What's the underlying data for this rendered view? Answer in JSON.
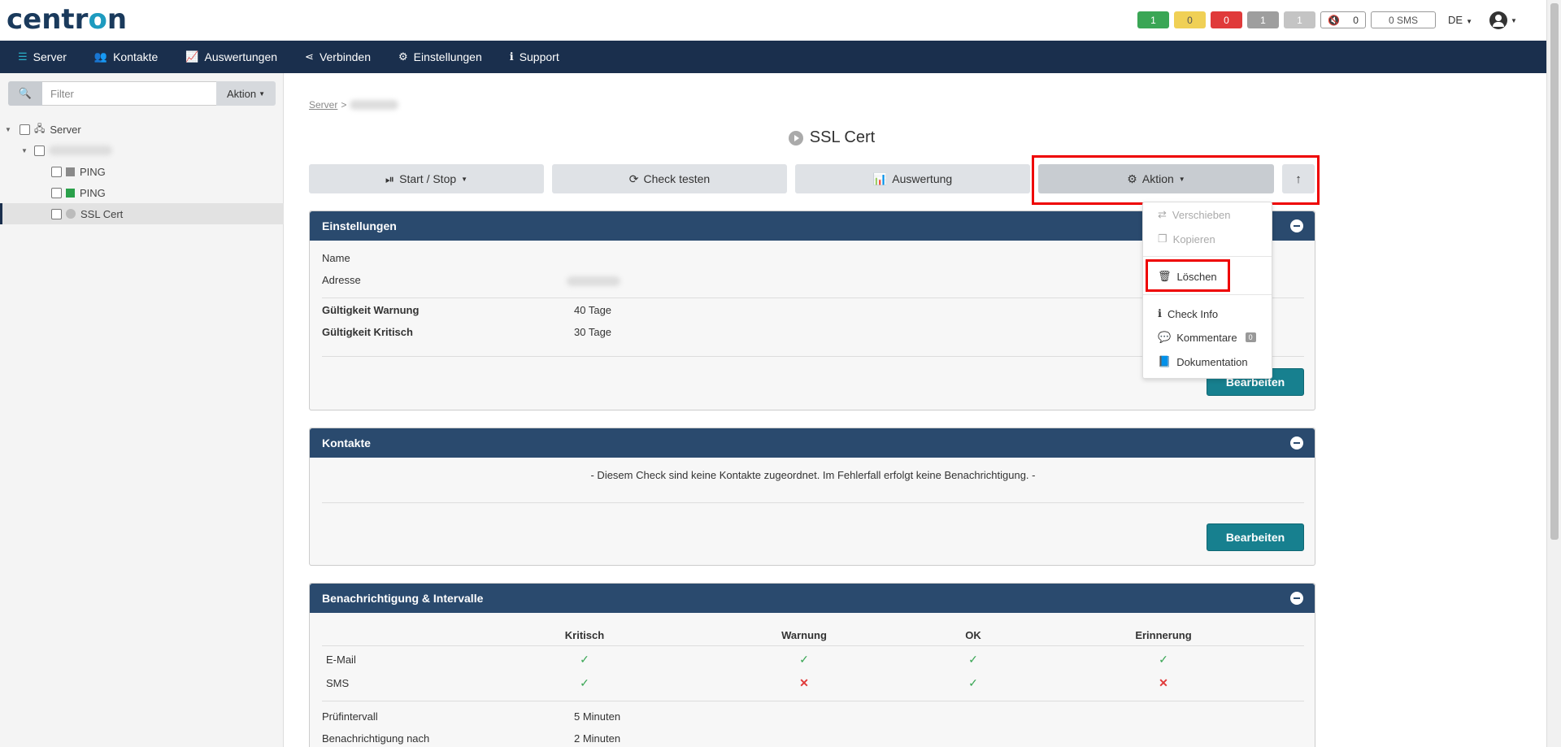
{
  "header": {
    "logo_main": "centr",
    "logo_accent": "o",
    "logo_tail": "n",
    "status": [
      "1",
      "0",
      "0",
      "1",
      "1"
    ],
    "mute_count": "0",
    "sms": "0 SMS",
    "lang": "DE"
  },
  "nav": {
    "items": [
      "Server",
      "Kontakte",
      "Auswertungen",
      "Verbinden",
      "Einstellungen",
      "Support"
    ]
  },
  "sidebar": {
    "filter_placeholder": "Filter",
    "aktion_label": "Aktion",
    "tree": {
      "root": "Server",
      "ping1": "PING",
      "ping2": "PING",
      "ssl": "SSL Cert"
    }
  },
  "main": {
    "breadcrumb_server": "Server",
    "breadcrumb_sep": ">",
    "title": "SSL Cert",
    "buttons": {
      "start_stop": "Start / Stop",
      "check_testen": "Check testen",
      "auswertung": "Auswertung",
      "aktion": "Aktion"
    },
    "einstellungen": {
      "title": "Einstellungen",
      "name_label": "Name",
      "adresse_label": "Adresse",
      "warn_label": "Gültigkeit Warnung",
      "warn_value": "40 Tage",
      "krit_label": "Gültigkeit Kritisch",
      "krit_value": "30 Tage",
      "edit": "Bearbeiten"
    },
    "kontakte": {
      "title": "Kontakte",
      "message": "- Diesem Check sind keine Kontakte zugeordnet. Im Fehlerfall erfolgt keine Benachrichtigung. -",
      "edit": "Bearbeiten"
    },
    "benachrichtigung": {
      "title": "Benachrichtigung & Intervalle",
      "columns": [
        "Kritisch",
        "Warnung",
        "OK",
        "Erinnerung"
      ],
      "rows": [
        {
          "label": "E-Mail",
          "values": [
            "yes",
            "yes",
            "yes",
            "yes"
          ]
        },
        {
          "label": "SMS",
          "values": [
            "yes",
            "no",
            "yes",
            "no"
          ]
        }
      ],
      "pruef_label": "Prüfintervall",
      "pruef_value": "5 Minuten",
      "nach_label": "Benachrichtigung nach",
      "nach_value": "2 Minuten"
    }
  },
  "dropdown": {
    "verschieben": "Verschieben",
    "kopieren": "Kopieren",
    "loeschen": "Löschen",
    "check_info": "Check Info",
    "kommentare": "Kommentare",
    "kommentare_count": "0",
    "dokumentation": "Dokumentation"
  },
  "colors": {
    "navbar": "#1a2f4d",
    "panel_header": "#2a4a6e",
    "teal_button": "#17808f",
    "highlight": "#ee0000"
  }
}
